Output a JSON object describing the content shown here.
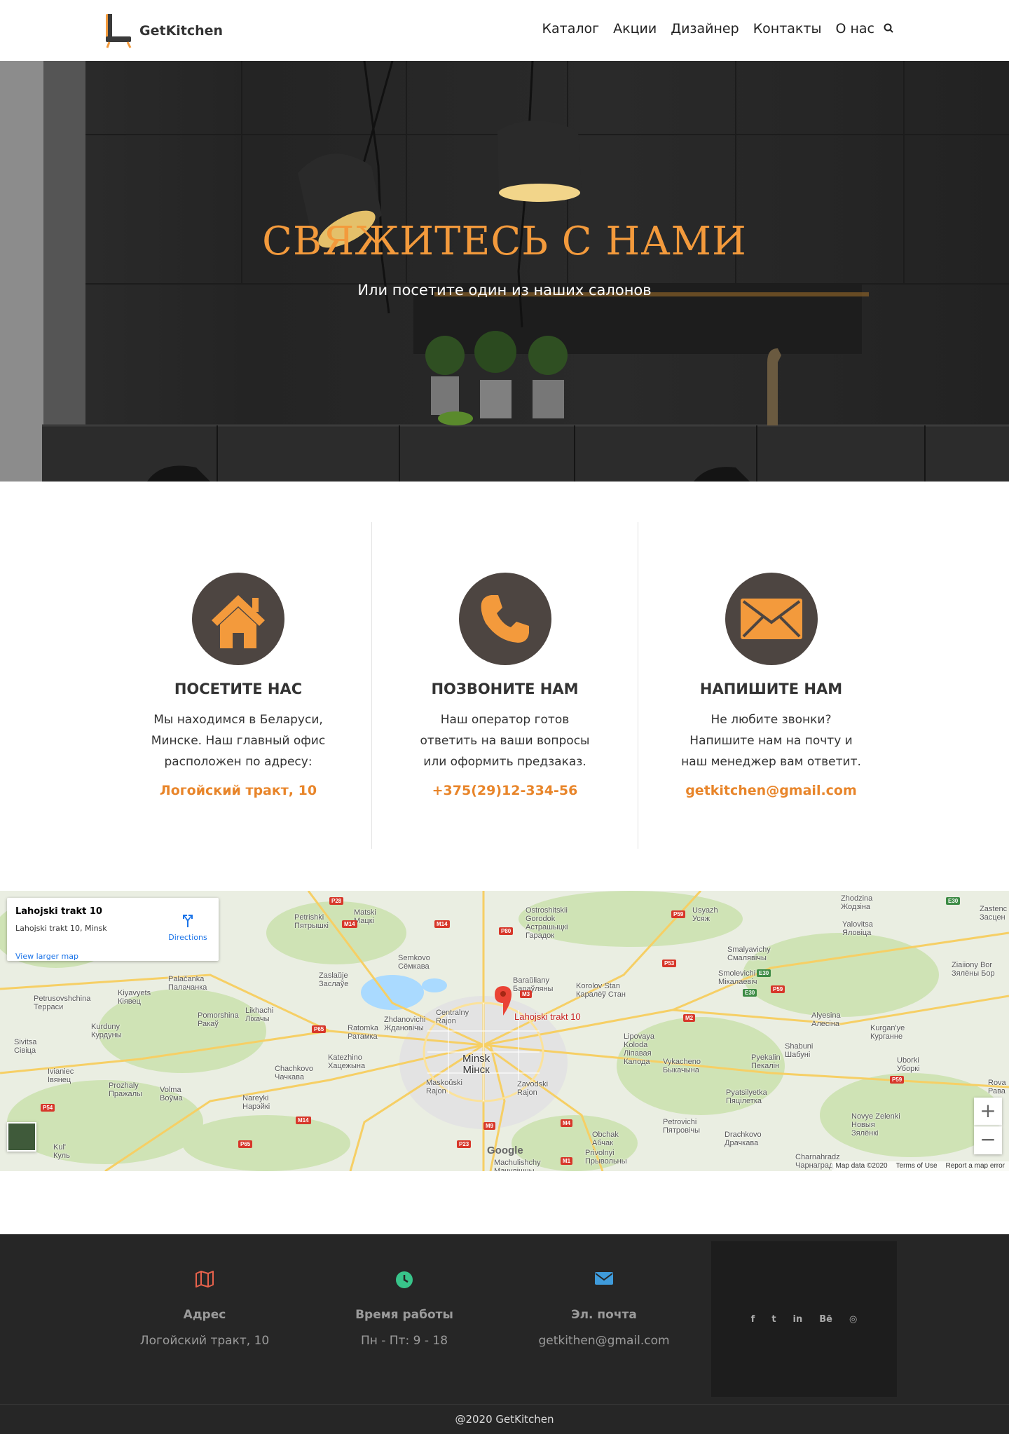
{
  "header": {
    "brand": "GetKitchen",
    "nav": [
      "Каталог",
      "Акции",
      "Дизайнер",
      "Контакты",
      "О нас"
    ]
  },
  "hero": {
    "title": "СВЯЖИТЕСЬ С НАМИ",
    "subtitle": "Или посетите один из наших салонов"
  },
  "cards": [
    {
      "icon": "house-icon",
      "title": "ПОСЕТИТЕ НАС",
      "text": "Мы находимся в Беларуси, Минске. Наш главный офис расположен по адресу:",
      "link": "Логойский тракт, 10"
    },
    {
      "icon": "phone-icon",
      "title": "ПОЗВОНИТЕ НАМ",
      "text": "Наш оператор готов ответить на ваши вопросы или оформить предзаказ.",
      "link": "+375(29)12-334-56"
    },
    {
      "icon": "envelope-icon",
      "title": "НАПИШИТЕ НАМ",
      "text": "Не любите звонки? Напишите нам на почту и наш менеджер вам ответит.",
      "link": "getkitchen@gmail.com"
    }
  ],
  "map": {
    "place_name": "Lahojski trakt 10",
    "place_address": "Lahojski trakt 10, Minsk",
    "directions_label": "Directions",
    "larger_map_link": "View larger map",
    "pin_label": "Lahojski trakt 10",
    "city_label": "Minsk\nМінск",
    "google_label": "Google",
    "footer": [
      "Map data ©2020",
      "Terms of Use",
      "Report a map error"
    ],
    "zoom_in": "+",
    "zoom_out": "−",
    "towns": [
      {
        "text": "Zhodzina\nЖодзіна"
      },
      {
        "text": "Ostroshitskii\nGorodok\nАстрашыцкі\nГарадок"
      },
      {
        "text": "Usyazh\nУсяж"
      },
      {
        "text": "Zastenc\nЗасцен"
      },
      {
        "text": "Yalovitsa\nЯловіца"
      },
      {
        "text": "Petrishki\nПятрышкі"
      },
      {
        "text": "Matski\nМацкі"
      },
      {
        "text": "Semkovo\nСёмкава"
      },
      {
        "text": "Smalyavichy\nСмалявічы"
      },
      {
        "text": "Ziaiiony Bor\nЗялёны Бор"
      },
      {
        "text": "Zaslaŭje\nЗаслаўе"
      },
      {
        "text": "Baraŭliany\nБараўляны"
      },
      {
        "text": "Korolov Stan\nКаралёў Стан"
      },
      {
        "text": "Smolevichi\nМікалаевіч"
      },
      {
        "text": "Palačanka\nПалачанка"
      },
      {
        "text": "Kiyavyets\nКіявец"
      },
      {
        "text": "Petrusovshchina\nТерраси"
      },
      {
        "text": "Lipovaya\nKoloda\nЛіпавая\nКалода"
      },
      {
        "text": "Alyesina\nАлесіна"
      },
      {
        "text": "Kurgan'ye\nКурганне"
      },
      {
        "text": "Pomorshina\nРакаў"
      },
      {
        "text": "Likhachi\nЛіхачы"
      },
      {
        "text": "Zhdanovichi\nЖдановічы"
      },
      {
        "text": "Centralny\nRajon"
      },
      {
        "text": "Ratomka\nРатамка"
      },
      {
        "text": "Kurduny\nКурдуны"
      },
      {
        "text": "Sivitsa\nСівіца"
      },
      {
        "text": "Katezhino\nХацежына"
      },
      {
        "text": "Vykacheno\nБыкачына"
      },
      {
        "text": "Shabuni\nШабуні"
      },
      {
        "text": "Pyekalin\nПекалін"
      },
      {
        "text": "Uborki\nУборкі"
      },
      {
        "text": "Chachkovo\nЧачкава"
      },
      {
        "text": "Ivianiec\nІвянец"
      },
      {
        "text": "Prozhaly\nПражалы"
      },
      {
        "text": "Volma\nВоўма"
      },
      {
        "text": "Maskoŭski\nRajon"
      },
      {
        "text": "Zavodski\nRajon"
      },
      {
        "text": "Pyatsilyetka\nПяцілетка"
      },
      {
        "text": "Rova\nРава"
      },
      {
        "text": "Nareyki\nНарэйкі"
      },
      {
        "text": "Novye Zelenki\nНовыя\nЗялёнкі"
      },
      {
        "text": "Petrovichi\nПятровічы"
      },
      {
        "text": "Obchak\nАбчак"
      },
      {
        "text": "Drachkovo\nДрачкава"
      },
      {
        "text": "Kul'\nКуль"
      },
      {
        "text": "Privolnyi\nПрывольны"
      },
      {
        "text": "Machulishchy\nМачулішчы"
      },
      {
        "text": "Charnahradz\nЧарнаград"
      }
    ],
    "roads": [
      "P28",
      "M14",
      "M14",
      "P80",
      "P59",
      "P53",
      "E30",
      "E30",
      "M3",
      "P59",
      "M2",
      "P65",
      "P54",
      "M14",
      "M9",
      "M4",
      "P23",
      "M1",
      "P65",
      "P59",
      "E30"
    ]
  },
  "footer": {
    "columns": [
      {
        "icon": "map-icon",
        "color": "#e8624c",
        "label": "Адрес",
        "value": "Логойский тракт, 10"
      },
      {
        "icon": "clock-icon",
        "color": "#38c48a",
        "label": "Время работы",
        "value": "Пн - Пт: 9 - 18"
      },
      {
        "icon": "envelope-icon",
        "color": "#3f9bdb",
        "label": "Эл. почта",
        "value": "getkithen@gmail.com"
      }
    ],
    "social": [
      "f",
      "t",
      "in",
      "Bē",
      "◎"
    ],
    "copyright": "@2020 GetKitchen"
  },
  "colors": {
    "accent": "#f39a3c",
    "link": "#e8852a",
    "icon_circle": "#4d4541",
    "footer_bg": "#262626"
  }
}
